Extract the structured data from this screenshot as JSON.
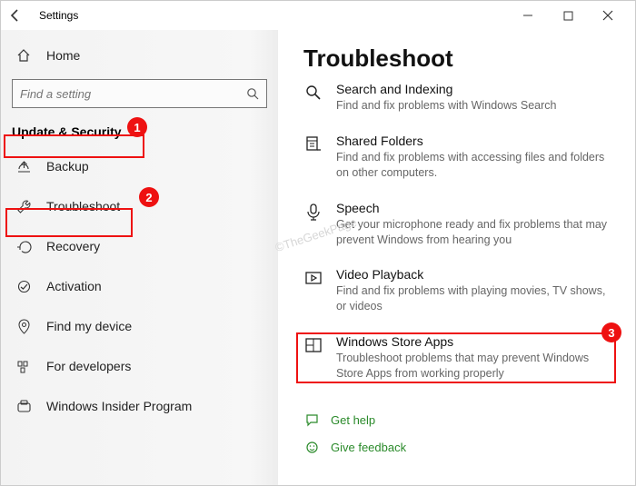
{
  "window": {
    "title": "Settings"
  },
  "sidebar": {
    "home": "Home",
    "searchPlaceholder": "Find a setting",
    "sectionHeader": "Update & Security",
    "items": [
      {
        "label": "Backup"
      },
      {
        "label": "Troubleshoot"
      },
      {
        "label": "Recovery"
      },
      {
        "label": "Activation"
      },
      {
        "label": "Find my device"
      },
      {
        "label": "For developers"
      },
      {
        "label": "Windows Insider Program"
      }
    ]
  },
  "main": {
    "title": "Troubleshoot",
    "items": [
      {
        "title": "Search and Indexing",
        "desc": "Find and fix problems with Windows Search"
      },
      {
        "title": "Shared Folders",
        "desc": "Find and fix problems with accessing files and folders on other computers."
      },
      {
        "title": "Speech",
        "desc": "Get your microphone ready and fix problems that may prevent Windows from hearing you"
      },
      {
        "title": "Video Playback",
        "desc": "Find and fix problems with playing movies, TV shows, or videos"
      },
      {
        "title": "Windows Store Apps",
        "desc": "Troubleshoot problems that may prevent Windows Store Apps from working properly"
      }
    ],
    "help": {
      "getHelp": "Get help",
      "giveFeedback": "Give feedback"
    }
  },
  "annotations": {
    "badge1": "1",
    "badge2": "2",
    "badge3": "3"
  },
  "watermark": "©TheGeekPage"
}
